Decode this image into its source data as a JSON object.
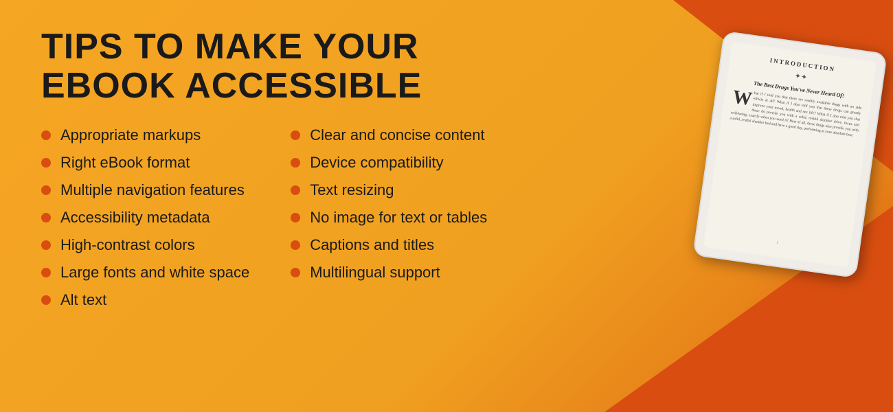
{
  "page": {
    "title": "Tips to Make Your eBook Accessible",
    "background_color": "#F5A623",
    "accent_color": "#D94E10"
  },
  "left_list": {
    "items": [
      "Appropriate markups",
      "Right eBook format",
      "Multiple navigation features",
      "Accessibility metadata",
      "High-contrast colors",
      "Large fonts and white space",
      "Alt text"
    ]
  },
  "right_list": {
    "items": [
      "Clear and concise content",
      "Device compatibility",
      "Text resizing",
      "No image for text or tables",
      "Captions and titles",
      "Multilingual support"
    ]
  },
  "ereader": {
    "chapter": "Introduction",
    "divider": "✦✦",
    "subtitle": "The Best Drugs You've Never Heard Of!",
    "body_text": "hat if I told you that there are readily available drugs with no side effects at all? What if I also told you that these drugs can greatly improve your mood, health and sex life? What if I also told you that these do provide you with a solid, restful slumber drive, focus and well-being, exactly when you need it? Best of all, these drugs also provide you with a solid, restful slumber bed and have a good day, performing at your absolute best.",
    "drop_cap": "W",
    "page_number": "1"
  }
}
